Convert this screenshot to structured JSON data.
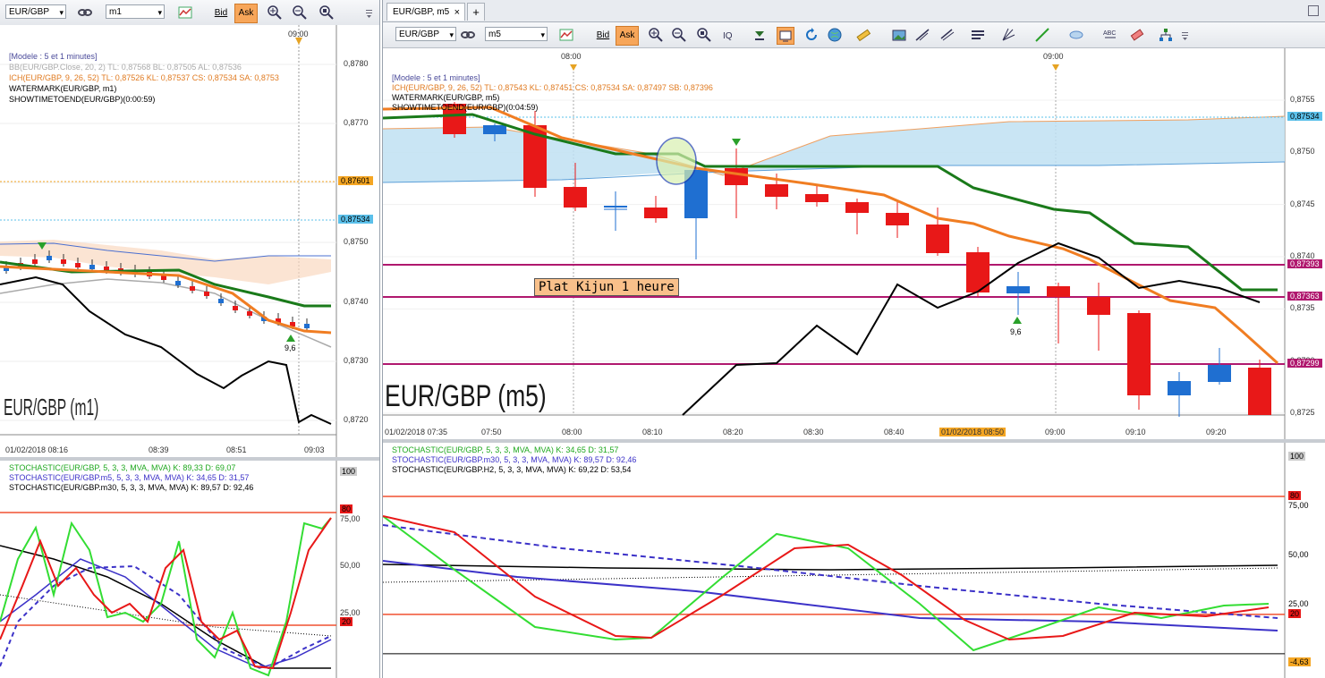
{
  "left_window": {
    "symbol": "EUR/GBP",
    "timeframe": "m1",
    "bid_label": "Bid",
    "ask_label": "Ask",
    "time_marker": "09:00",
    "legend": [
      {
        "text": "[Modele : 5 et 1 minutes]",
        "color": "#4a4a9a"
      },
      {
        "text": "BB(EUR/GBP.Close, 20, 2)   TL: 0,87568   BL: 0,87505   AL: 0,87536",
        "color": "#aaaaaa"
      },
      {
        "text": "ICH(EUR/GBP, 9, 26, 52)   TL: 0,87526   KL: 0,87537   CS: 0,87534   SA: 0,8753",
        "color": "#e07a20"
      },
      {
        "text": "WATERMARK(EUR/GBP, m1)",
        "color": "#000000"
      },
      {
        "text": "SHOWTIMETOEND(EUR/GBP)(0:00:59)",
        "color": "#000000"
      }
    ],
    "price_ticks": [
      "0,8780",
      "0,8770",
      "0,8760",
      "0,8750",
      "0,8740",
      "0,8730",
      "0,8720"
    ],
    "price_tags": [
      {
        "text": "0,87601",
        "color": "#f5a623"
      },
      {
        "text": "0,87534",
        "color": "#5bc0ea"
      }
    ],
    "signal_label": "9,6",
    "watermark": "EUR/GBP (m1)",
    "time_ticks": [
      "01/02/2018 08:16",
      "08:39",
      "08:51",
      "09:03"
    ],
    "stoch_legend": [
      {
        "text": "STOCHASTIC(EUR/GBP, 5, 3, 3, MVA, MVA)   K: 89,33   D: 69,07",
        "color": "#1fa81f"
      },
      {
        "text": "STOCHASTIC(EUR/GBP.m5, 5, 3, 3, MVA, MVA)   K: 34,65   D: 31,57",
        "color": "#3c32c8"
      },
      {
        "text": "STOCHASTIC(EUR/GBP.m30, 5, 3, 3, MVA, MVA)   K: 89,57   D: 92,46",
        "color": "#000000"
      }
    ],
    "stoch_ticks": [
      "100",
      "80",
      "75,00",
      "50,00",
      "25,00",
      "20"
    ]
  },
  "right_window": {
    "tab_label": "EUR/GBP, m5",
    "symbol": "EUR/GBP",
    "timeframe": "m5",
    "bid_label": "Bid",
    "ask_label": "Ask",
    "time_markers": [
      "08:00",
      "09:00"
    ],
    "legend": [
      {
        "text": "[Modele : 5 et 1 minutes]",
        "color": "#4a4a9a"
      },
      {
        "text": "ICH(EUR/GBP, 9, 26, 52)   TL: 0,87543   KL: 0,87451   CS: 0,87534   SA: 0,87497   SB: 0,87396",
        "color": "#e07a20"
      },
      {
        "text": "WATERMARK(EUR/GBP, m5)",
        "color": "#000000"
      },
      {
        "text": "SHOWTIMETOEND(EUR/GBP)(0:04:59)",
        "color": "#000000"
      }
    ],
    "price_ticks": [
      "0,8755",
      "0,8750",
      "0,8745",
      "0,8740",
      "0,8735",
      "0,8730",
      "0,8725"
    ],
    "price_tags": [
      {
        "text": "0,87534",
        "color": "#5bc0ea"
      },
      {
        "text": "0,87393",
        "color": "#b0186e"
      },
      {
        "text": "0,87363",
        "color": "#b0186e"
      },
      {
        "text": "0,87299",
        "color": "#b0186e"
      }
    ],
    "annotation": "Plat Kijun 1 heure",
    "signal_label": "9,6",
    "watermark": "EUR/GBP (m5)",
    "time_ticks": [
      "01/02/2018 07:35",
      "07:50",
      "08:00",
      "08:10",
      "08:20",
      "08:30",
      "08:40",
      "01/02/2018 08:50",
      "09:00",
      "09:10",
      "09:20"
    ],
    "stoch_legend": [
      {
        "text": "STOCHASTIC(EUR/GBP, 5, 3, 3, MVA, MVA)   K: 34,65   D: 31,57",
        "color": "#1fa81f"
      },
      {
        "text": "STOCHASTIC(EUR/GBP.m30, 5, 3, 3, MVA, MVA)   K: 89,57   D: 92,46",
        "color": "#3c32c8"
      },
      {
        "text": "STOCHASTIC(EUR/GBP.H2, 5, 3, 3, MVA, MVA)   K: 69,22   D: 53,54",
        "color": "#000000"
      }
    ],
    "stoch_ticks": [
      "100",
      "80",
      "75,00",
      "50,00",
      "25,00",
      "20",
      "-4,63"
    ]
  },
  "colors": {
    "bull_candle": "#1f6fd1",
    "bear_candle": "#e81818",
    "kijun": "#1a7a1a",
    "tenkan": "#f07d22",
    "chikou": "#000000",
    "cloud": "#bfe0f2",
    "level_line": "#b0186e",
    "active_button": "#f7a65a"
  }
}
